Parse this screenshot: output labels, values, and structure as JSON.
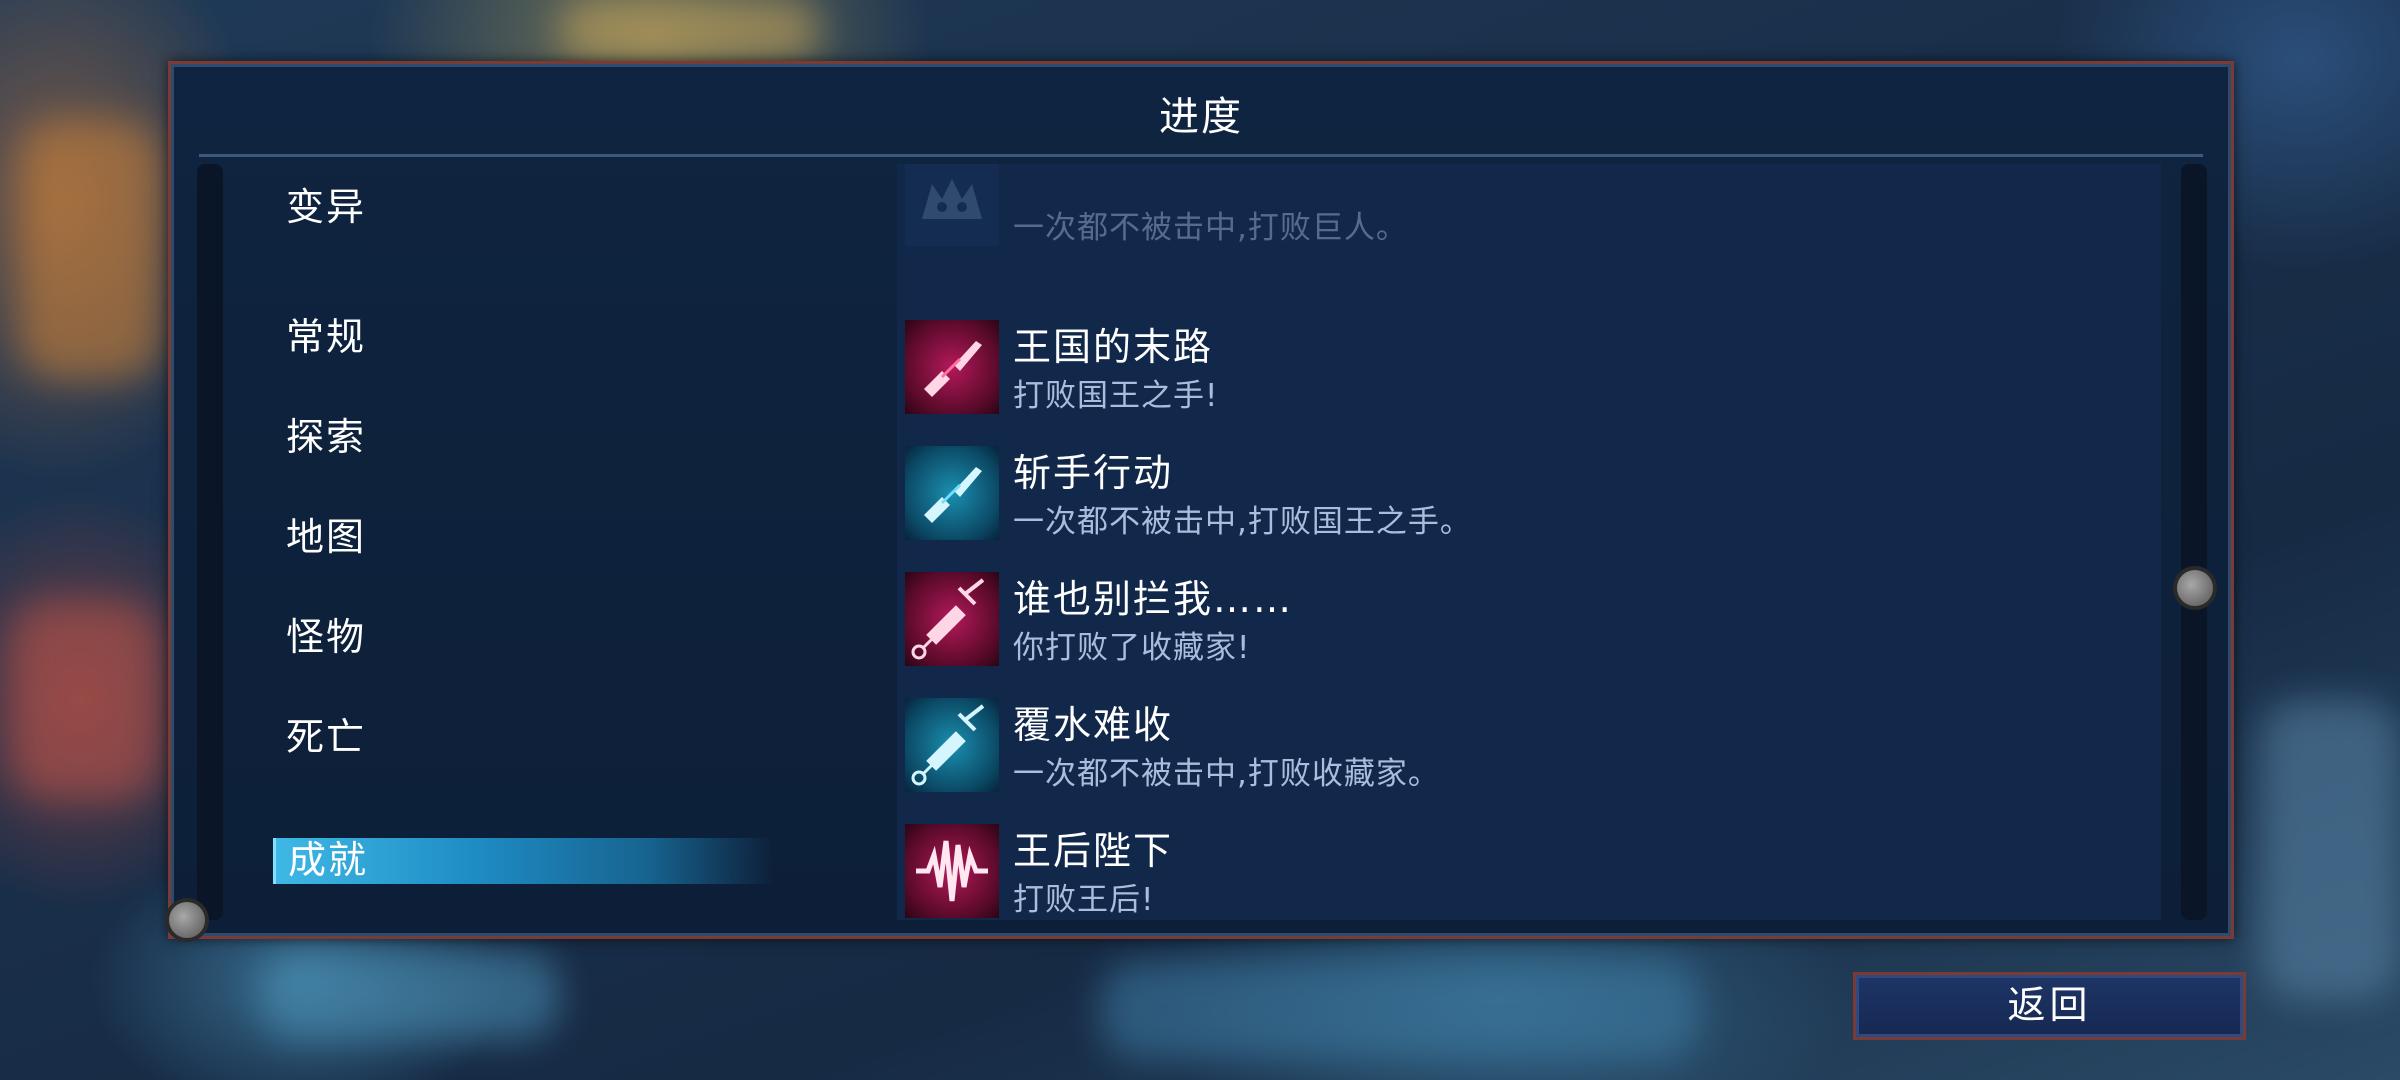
{
  "panel": {
    "title": "进度"
  },
  "menu": {
    "items": [
      {
        "label": "变异",
        "selected": false
      },
      {
        "label": "常规",
        "selected": false
      },
      {
        "label": "探索",
        "selected": false
      },
      {
        "label": "地图",
        "selected": false
      },
      {
        "label": "怪物",
        "selected": false
      },
      {
        "label": "死亡",
        "selected": false
      },
      {
        "label": "成就",
        "selected": true
      }
    ]
  },
  "achievements": [
    {
      "name": "",
      "desc": "一次都不被击中,打败巨人。",
      "icon": "giant-skull-icon",
      "color": "dim"
    },
    {
      "name": "王国的末路",
      "desc": "打败国王之手!",
      "icon": "broken-sword-icon",
      "color": "pink"
    },
    {
      "name": "斩手行动",
      "desc": "一次都不被击中,打败国王之手。",
      "icon": "broken-sword-icon",
      "color": "cyan"
    },
    {
      "name": "谁也别拦我……",
      "desc": "你打败了收藏家!",
      "icon": "syringe-icon",
      "color": "pink"
    },
    {
      "name": "覆水难收",
      "desc": "一次都不被击中,打败收藏家。",
      "icon": "syringe-icon",
      "color": "cyan"
    },
    {
      "name": "王后陛下",
      "desc": "打败王后!",
      "icon": "sound-wave-icon",
      "color": "pink"
    },
    {
      "name": "???",
      "desc": "",
      "icon": "locked-icon",
      "color": "dim"
    }
  ],
  "back_button": {
    "label": "返回"
  },
  "colors": {
    "accent_pink": "#e8185e",
    "accent_cyan": "#2ec8ee",
    "selected_bg": "#2aa6d9",
    "frame_border": "#7a3b35"
  }
}
